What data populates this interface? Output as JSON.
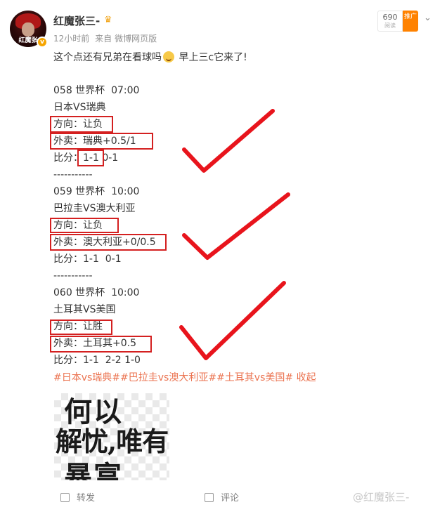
{
  "header": {
    "avatar_label": "红魔张",
    "username": "红魔张三-",
    "time": "12小时前",
    "source_prefix": "来自",
    "source": "微博网页版",
    "reads_count": "690",
    "reads_label": "阅读",
    "promote_label": "推广"
  },
  "post": {
    "intro": "这个点还有兄弟在看球吗",
    "intro_tail": "   早上三c它来了!",
    "matches": [
      {
        "title": "058 世界杯  07:00",
        "teams": "日本VS瑞典",
        "direction": "方向：让负",
        "pick": "外卖：瑞典+0.5/1",
        "score_label": "比分：",
        "score_a": "1-1",
        "score_b": " 0-1",
        "separator": "-----------"
      },
      {
        "title": "059 世界杯  10:00",
        "teams": "巴拉圭VS澳大利亚",
        "direction": "方向：让负",
        "pick": "外卖：澳大利亚+0/0.5",
        "score": "比分：1-1  0-1",
        "separator": "-----------"
      },
      {
        "title": "060 世界杯  10:00",
        "teams": "土耳其VS美国",
        "direction": "方向：让胜",
        "pick": "外卖：土耳其+0.5",
        "score": "比分：1-1  2-2 1-0"
      }
    ],
    "topics": "#日本vs瑞典##巴拉圭vs澳大利亚##土耳其vs美国#",
    "collapse": "收起"
  },
  "image": {
    "line1": "何以",
    "line2": "解忧,唯有",
    "line3": "暴富"
  },
  "actions": {
    "repost": "转发",
    "comment": "评论"
  },
  "watermark": "@红魔张三-",
  "colors": {
    "highlight_box": "#d42020",
    "checkmark": "#e8141c",
    "topic_link": "#eb7350",
    "promote": "#ff8200"
  }
}
